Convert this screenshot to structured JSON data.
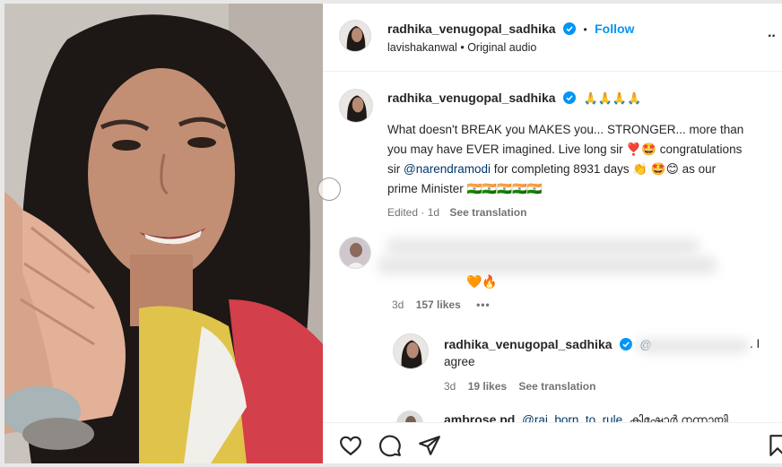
{
  "header": {
    "username": "radhika_venugopal_sadhika",
    "separator": "•",
    "follow_label": "Follow",
    "audio_user": "lavishakanwal",
    "audio_sep": "•",
    "audio_label": "Original audio",
    "more_label": "··"
  },
  "caption": {
    "username": "radhika_venugopal_sadhika",
    "emoji": "🙏🙏🙏🙏",
    "line1": "What doesn't BREAK you MAKES you... STRONGER... more than",
    "line2_a": "you may have EVER imagined. Live long sir ",
    "line2_b": "❣️🤩",
    "line2_c": " congratulations",
    "line3_a": "sir ",
    "line3_mention": "@narendramodi",
    "line3_b": " for completing 8931 days ",
    "line3_c": "👏 🤩😊",
    "line3_d": " as our",
    "line4": "prime Minister 🇮🇳🇮🇳🇮🇳🇮🇳🇮🇳",
    "edited": "Edited",
    "dot": "·",
    "time": "1d",
    "see_translation": "See translation"
  },
  "comment1": {
    "emoji": "🧡🔥",
    "time": "3d",
    "likes": "157 likes",
    "more": "•••"
  },
  "reply1": {
    "username": "radhika_venugopal_sadhika",
    "mention_prefix": "@",
    "text_end": ". I",
    "text_line2": "agree",
    "time": "3d",
    "likes": "19 likes",
    "see_translation": "See translation"
  },
  "reply2": {
    "username": "ambrose.pd",
    "mention": "@raj_born_to_rule",
    "text": "കിഷോർ നന്നായി"
  },
  "icons": {
    "like": "heart-icon",
    "comment": "comment-icon",
    "share": "share-icon",
    "save": "bookmark-icon",
    "verified_color": "#0095f6"
  }
}
